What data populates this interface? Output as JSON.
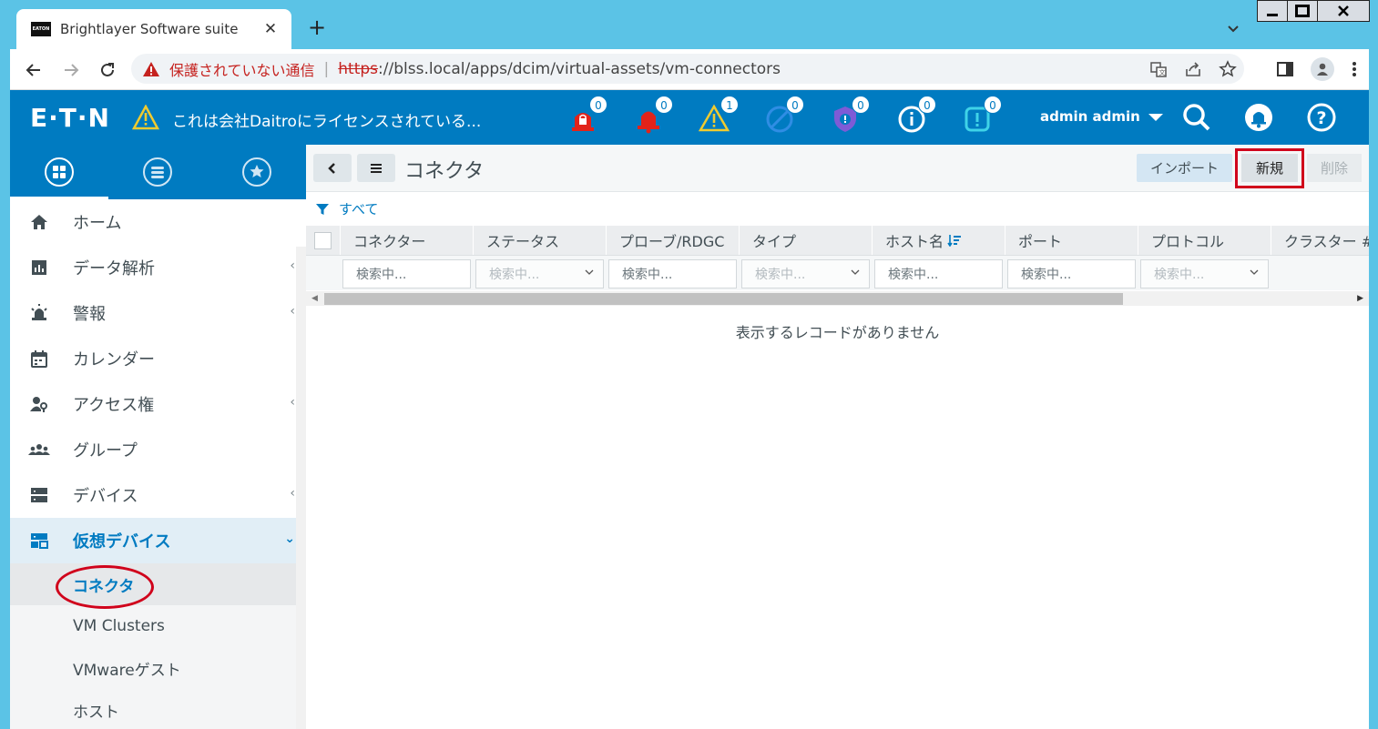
{
  "browser": {
    "tab_title": "Brightlayer Software suite",
    "tab_favicon_text": "EATON",
    "tab_close": "✕",
    "new_tab": "+",
    "security_label": "保護されていない通信",
    "url_scheme": "https",
    "url_rest": "://blss.local/apps/dcim/virtual-assets/vm-connectors"
  },
  "header": {
    "logo": "E·T·N",
    "license_text": "これは会社Daitroにライセンスされている...",
    "badges": [
      {
        "icon": "lock-alarm-icon",
        "count": "0",
        "color": "#e2231a"
      },
      {
        "icon": "bell-alarm-icon",
        "count": "0",
        "color": "#e2231a"
      },
      {
        "icon": "warning-icon",
        "count": "1",
        "color": "#f0cb2f"
      },
      {
        "icon": "disabled-icon",
        "count": "0",
        "color": "#2f8de4"
      },
      {
        "icon": "shield-alert-icon",
        "count": "0",
        "color": "#7e5bd6"
      },
      {
        "icon": "info-icon",
        "count": "0",
        "color": "#ffffff"
      },
      {
        "icon": "notice-icon",
        "count": "0",
        "color": "#3fd3e8"
      }
    ],
    "user": "admin admin"
  },
  "sidebar": {
    "items": [
      {
        "label": "ホーム",
        "icon": "home-icon"
      },
      {
        "label": "データ解析",
        "icon": "analytics-icon"
      },
      {
        "label": "警報",
        "icon": "alarm-icon"
      },
      {
        "label": "カレンダー",
        "icon": "calendar-icon"
      },
      {
        "label": "アクセス権",
        "icon": "access-icon"
      },
      {
        "label": "グループ",
        "icon": "groups-icon"
      },
      {
        "label": "デバイス",
        "icon": "devices-icon"
      },
      {
        "label": "仮想デバイス",
        "icon": "virtual-devices-icon"
      }
    ],
    "subitems": [
      {
        "label": "コネクタ"
      },
      {
        "label": "VM Clusters"
      },
      {
        "label": "VMwareゲスト"
      },
      {
        "label": "ホスト"
      }
    ]
  },
  "main": {
    "title": "コネクタ",
    "import_label": "インポート",
    "new_label": "新規",
    "delete_label": "削除",
    "filter_label": "すべて",
    "columns": [
      "コネクター",
      "ステータス",
      "プローブ/RDGC",
      "タイプ",
      "ホスト名",
      "ポート",
      "プロトコル",
      "クラスター #"
    ],
    "filters": [
      {
        "placeholder": "検索中...",
        "type": "text"
      },
      {
        "placeholder": "検索中...",
        "type": "select"
      },
      {
        "placeholder": "検索中...",
        "type": "text"
      },
      {
        "placeholder": "検索中...",
        "type": "select"
      },
      {
        "placeholder": "検索中...",
        "type": "text"
      },
      {
        "placeholder": "検索中...",
        "type": "text"
      },
      {
        "placeholder": "検索中...",
        "type": "select"
      }
    ],
    "empty_message": "表示するレコードがありません"
  },
  "colors": {
    "brand_blue": "#007bc1",
    "highlight_red": "#d0021b"
  }
}
